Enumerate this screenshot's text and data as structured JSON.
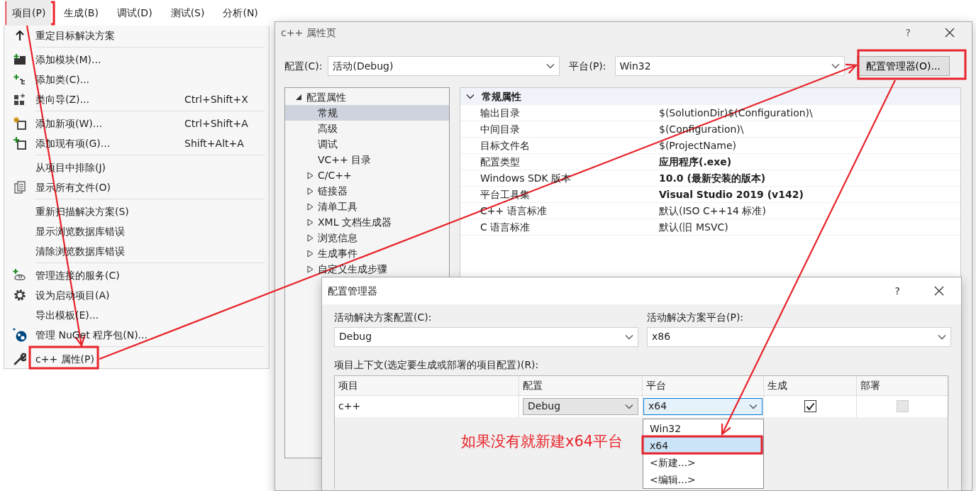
{
  "menu_bar": [
    {
      "label": "项目(P)",
      "selected": true
    },
    {
      "label": "生成(B)",
      "selected": false
    },
    {
      "label": "调试(D)",
      "selected": false
    },
    {
      "label": "测试(S)",
      "selected": false
    },
    {
      "label": "分析(N)",
      "selected": false
    }
  ],
  "project_menu": [
    [
      {
        "label": "重定目标解决方案"
      }
    ],
    [
      {
        "label": "添加模块(M)..."
      },
      {
        "label": "添加类(C)..."
      },
      {
        "label": "类向导(Z)...",
        "shortcut": "Ctrl+Shift+X"
      }
    ],
    [
      {
        "label": "添加新项(W)...",
        "shortcut": "Ctrl+Shift+A"
      },
      {
        "label": "添加现有项(G)...",
        "shortcut": "Shift+Alt+A"
      }
    ],
    [
      {
        "label": "从项目中排除(J)"
      },
      {
        "label": "显示所有文件(O)"
      }
    ],
    [
      {
        "label": "重新扫描解决方案(S)"
      },
      {
        "label": "显示浏览数据库错误"
      },
      {
        "label": "清除浏览数据库错误"
      }
    ],
    [
      {
        "label": "管理连接的服务(C)"
      },
      {
        "label": "设为启动项目(A)"
      },
      {
        "label": "导出模板(E)..."
      },
      {
        "label": "管理 NuGet 程序包(N)..."
      }
    ],
    [
      {
        "label": "c++ 属性(P)"
      }
    ]
  ],
  "property_pages": {
    "title": "c++ 属性页",
    "help": "?",
    "configuration_label": "配置(C):",
    "configuration": "活动(Debug)",
    "platform_label": "平台(P):",
    "platform": "Win32",
    "config_manager_button": "配置管理器(O)...",
    "tree": [
      {
        "label": "配置属性",
        "expanded": true,
        "children": [
          {
            "label": "常规",
            "kind": "page",
            "selected": true
          },
          {
            "label": "高级",
            "kind": "page",
            "selected": false
          },
          {
            "label": "调试",
            "kind": "page",
            "selected": false
          },
          {
            "label": "VC++ 目录",
            "kind": "page",
            "selected": false
          },
          {
            "label": "C/C++",
            "kind": "group",
            "selected": false
          },
          {
            "label": "链接器",
            "kind": "group",
            "selected": false
          },
          {
            "label": "清单工具",
            "kind": "group",
            "selected": false
          },
          {
            "label": "XML 文档生成器",
            "kind": "group",
            "selected": false
          },
          {
            "label": "浏览信息",
            "kind": "group",
            "selected": false
          },
          {
            "label": "生成事件",
            "kind": "group",
            "selected": false
          },
          {
            "label": "自定义生成步骤",
            "kind": "group",
            "selected": false
          }
        ]
      }
    ],
    "grid": {
      "category": "常规属性",
      "expanded": true,
      "rows": [
        {
          "name": "输出目录",
          "value": "$(SolutionDir)$(Configuration)\\",
          "bold": false
        },
        {
          "name": "中间目录",
          "value": "$(Configuration)\\",
          "bold": false
        },
        {
          "name": "目标文件名",
          "value": "$(ProjectName)",
          "bold": false
        },
        {
          "name": "配置类型",
          "value": "应用程序(.exe)",
          "bold": true
        },
        {
          "name": "Windows SDK 版本",
          "value": "10.0 (最新安装的版本)",
          "bold": true
        },
        {
          "name": "平台工具集",
          "value": "Visual Studio 2019 (v142)",
          "bold": true
        },
        {
          "name": "C++ 语言标准",
          "value": "默认(ISO C++14 标准)",
          "bold": false
        },
        {
          "name": "C 语言标准",
          "value": "默认(旧 MSVC)",
          "bold": false
        }
      ]
    }
  },
  "configuration_manager": {
    "title": "配置管理器",
    "help": "?",
    "solution_config_label": "活动解决方案配置(C):",
    "solution_config": "Debug",
    "solution_platform_label": "活动解决方案平台(P):",
    "solution_platform": "x86",
    "contexts_label": "项目上下文(选定要生成或部署的项目配置)(R):",
    "columns": [
      "项目",
      "配置",
      "平台",
      "生成",
      "部署"
    ],
    "rows": [
      {
        "project": "c++",
        "configuration": "Debug",
        "platform": "x64",
        "build": true,
        "deploy": false,
        "deploy_enabled": false
      }
    ],
    "platform_options": [
      {
        "label": "Win32",
        "selected": false
      },
      {
        "label": "x64",
        "selected": true
      },
      {
        "label": "<新建...>",
        "selected": false
      },
      {
        "label": "<编辑...>",
        "selected": false
      }
    ]
  },
  "annotation": {
    "text": "如果没有就新建x64平台"
  }
}
